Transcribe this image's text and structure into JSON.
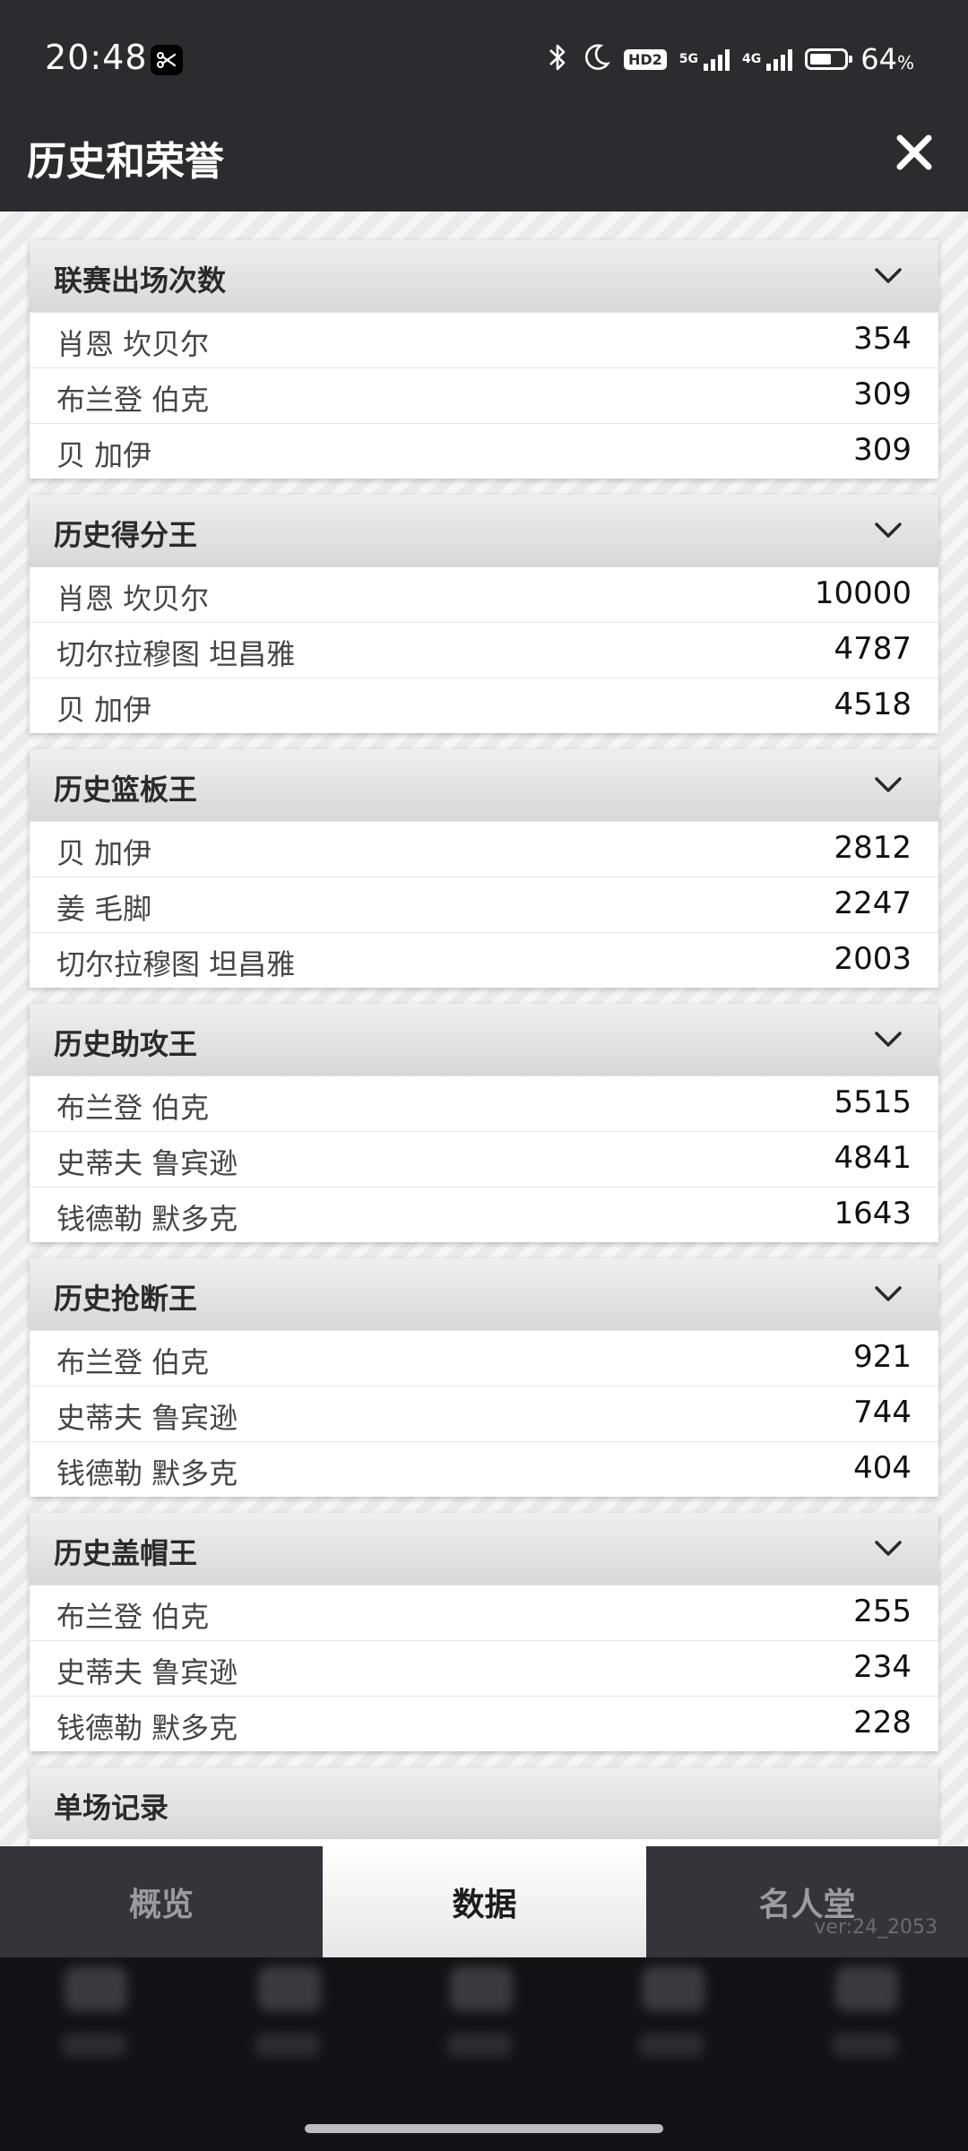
{
  "status": {
    "time": "20:48",
    "hd_label": "HD2",
    "net1": "5G",
    "net2": "4G",
    "battery_percent": 64,
    "battery_text": "64",
    "battery_unit": "%"
  },
  "header": {
    "title": "历史和荣誉"
  },
  "sections": [
    {
      "title": "联赛出场次数",
      "rows": [
        {
          "name": "肖恩 坎贝尔",
          "value": "354"
        },
        {
          "name": "布兰登 伯克",
          "value": "309"
        },
        {
          "name": "贝 加伊",
          "value": "309"
        }
      ]
    },
    {
      "title": "历史得分王",
      "rows": [
        {
          "name": "肖恩 坎贝尔",
          "value": "10000"
        },
        {
          "name": "切尔拉穆图 坦昌雅",
          "value": "4787"
        },
        {
          "name": "贝 加伊",
          "value": "4518"
        }
      ]
    },
    {
      "title": "历史篮板王",
      "rows": [
        {
          "name": "贝 加伊",
          "value": "2812"
        },
        {
          "name": "姜 毛脚",
          "value": "2247"
        },
        {
          "name": "切尔拉穆图 坦昌雅",
          "value": "2003"
        }
      ]
    },
    {
      "title": "历史助攻王",
      "rows": [
        {
          "name": "布兰登 伯克",
          "value": "5515"
        },
        {
          "name": "史蒂夫 鲁宾逊",
          "value": "4841"
        },
        {
          "name": "钱德勒 默多克",
          "value": "1643"
        }
      ]
    },
    {
      "title": "历史抢断王",
      "rows": [
        {
          "name": "布兰登 伯克",
          "value": "921"
        },
        {
          "name": "史蒂夫 鲁宾逊",
          "value": "744"
        },
        {
          "name": "钱德勒 默多克",
          "value": "404"
        }
      ]
    },
    {
      "title": "历史盖帽王",
      "rows": [
        {
          "name": "布兰登 伯克",
          "value": "255"
        },
        {
          "name": "史蒂夫 鲁宾逊",
          "value": "234"
        },
        {
          "name": "钱德勒 默多克",
          "value": "228"
        }
      ]
    },
    {
      "title": "单场记录",
      "rows": []
    }
  ],
  "tabs": [
    {
      "label": "概览",
      "active": false
    },
    {
      "label": "数据",
      "active": true
    },
    {
      "label": "名人堂",
      "active": false
    }
  ],
  "footer": {
    "version": "ver:24_2053"
  }
}
